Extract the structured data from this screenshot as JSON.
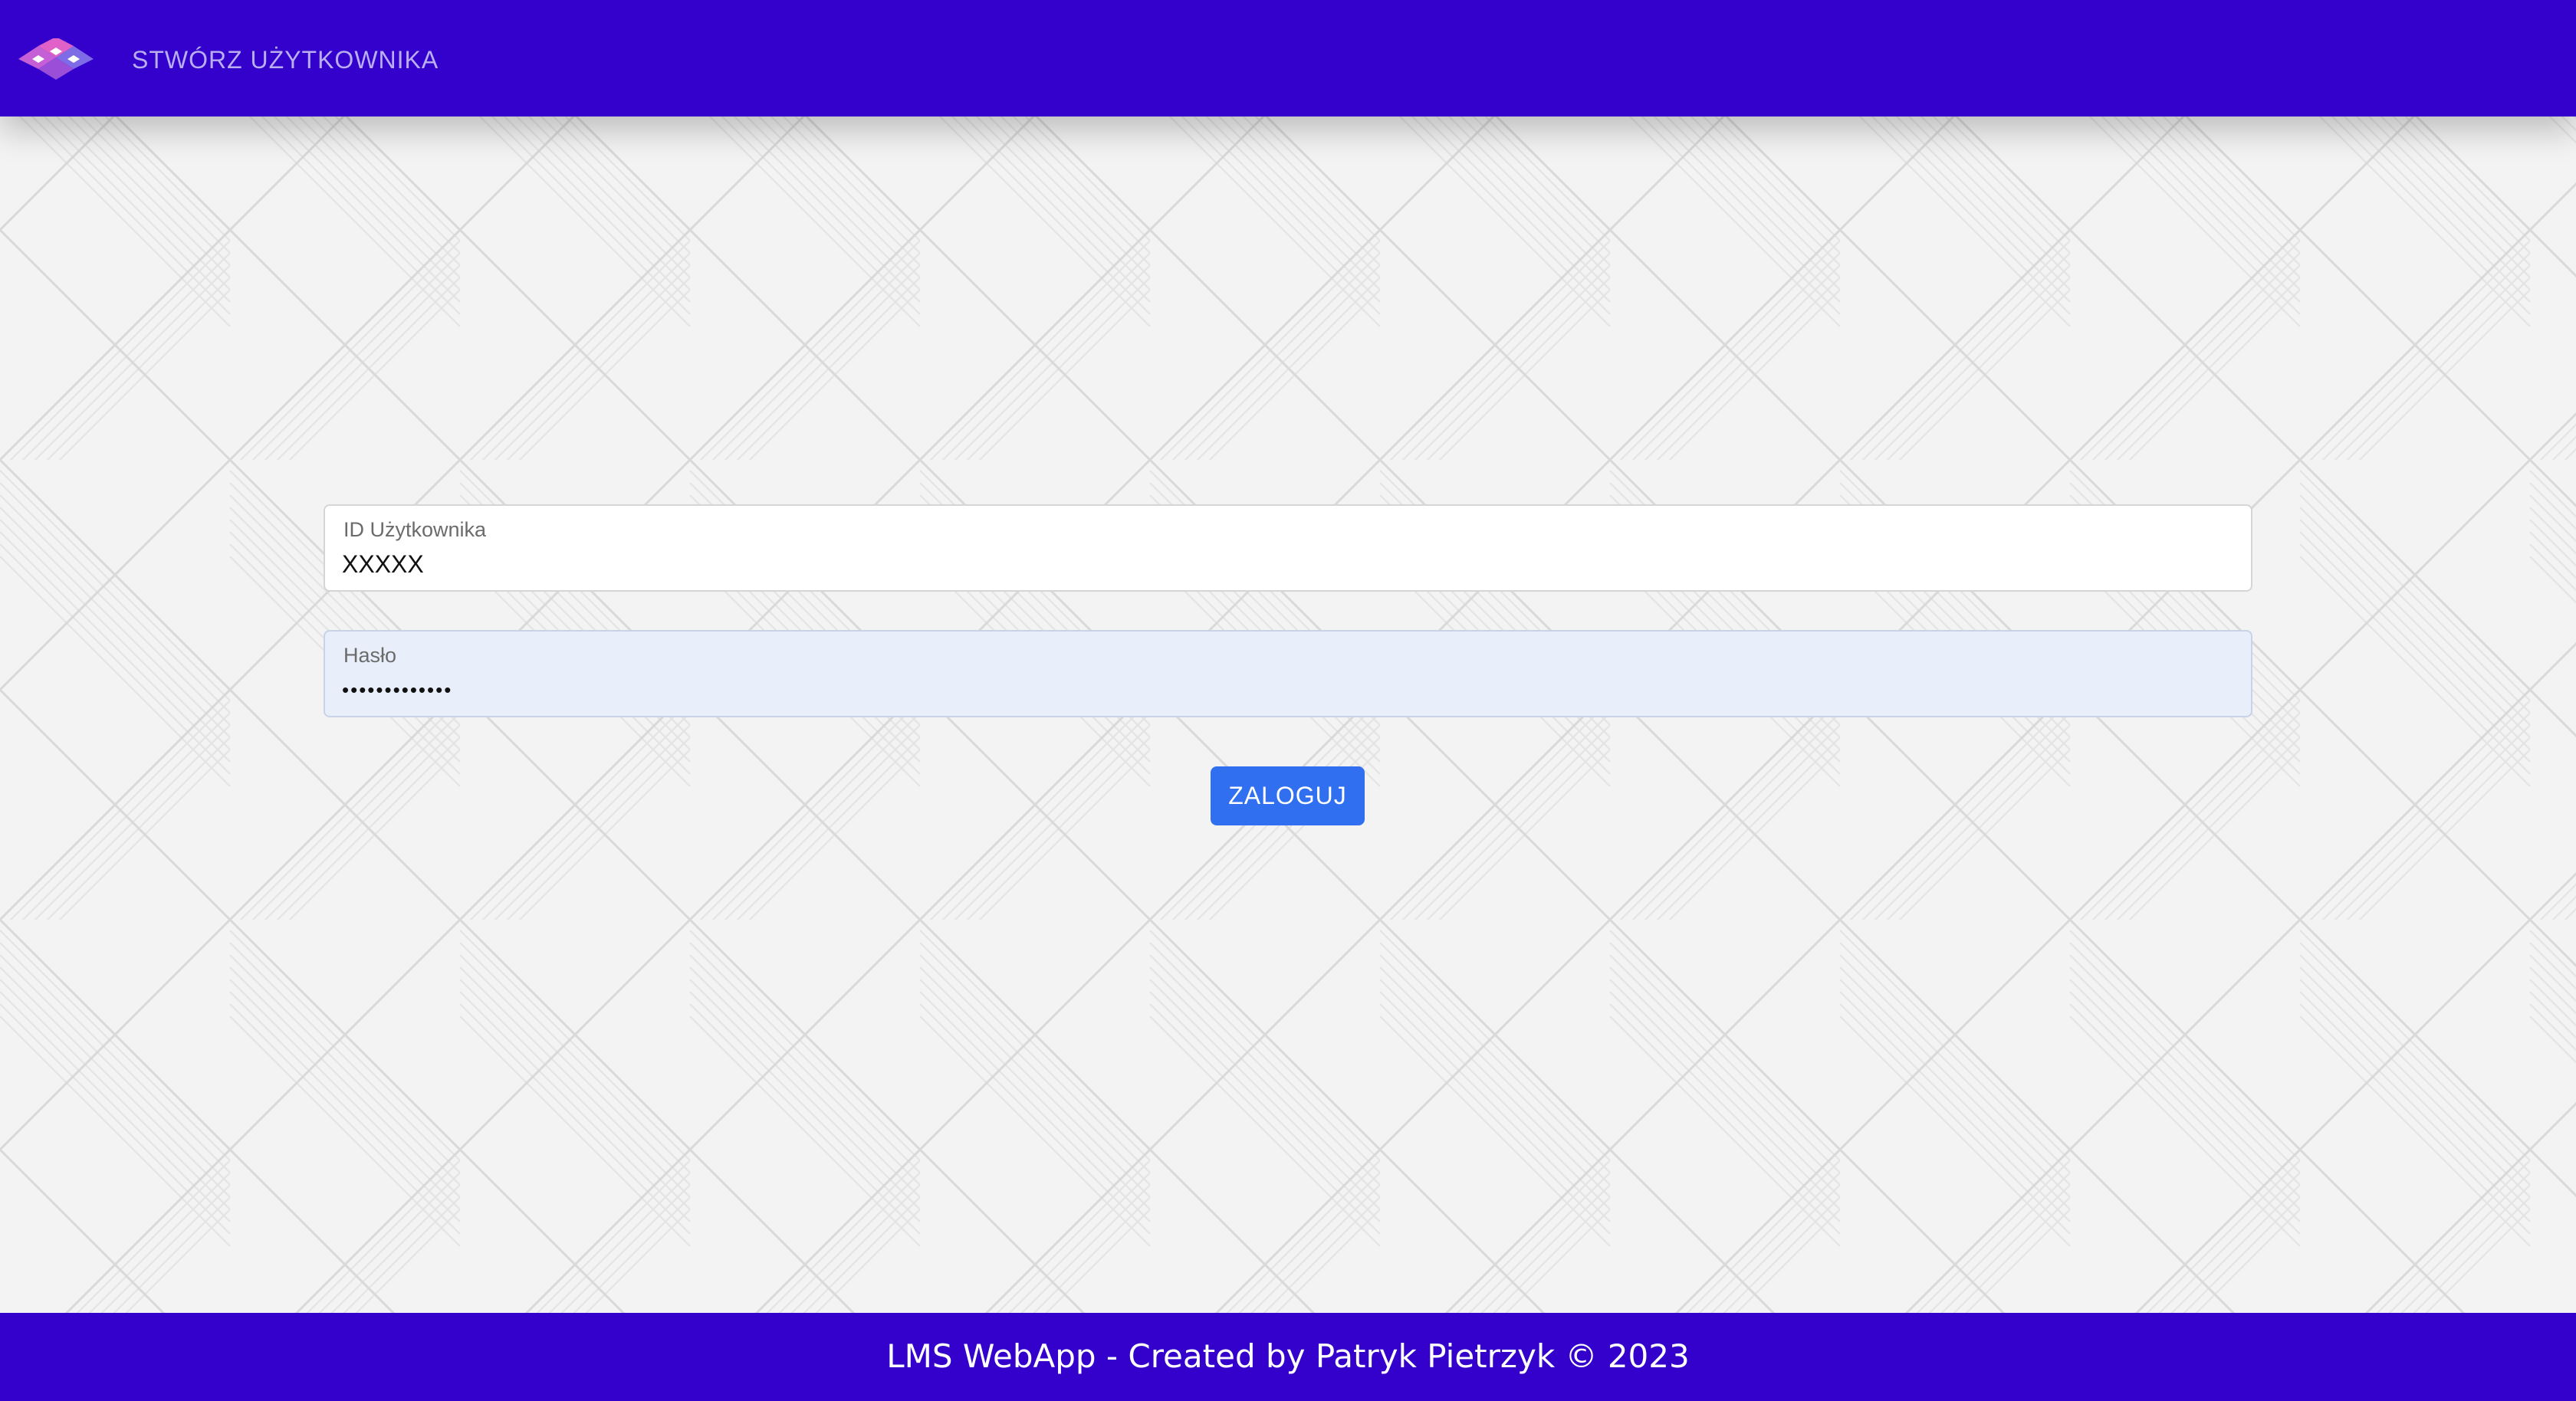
{
  "navbar": {
    "brand_logo": "lms-diamond-logo",
    "nav_link": "STWÓRZ UŻYTKOWNIKA",
    "background_color": "#3300cc"
  },
  "login_form": {
    "user_id": {
      "label": "ID Użytkownika",
      "value": "XXXXX"
    },
    "password": {
      "label": "Hasło",
      "value": "•••••••••••••"
    },
    "submit_label": "ZALOGUJ",
    "submit_color": "#2f6ff0"
  },
  "footer": {
    "text": "LMS WebApp - Created by Patryk Pietrzyk © 2023"
  }
}
